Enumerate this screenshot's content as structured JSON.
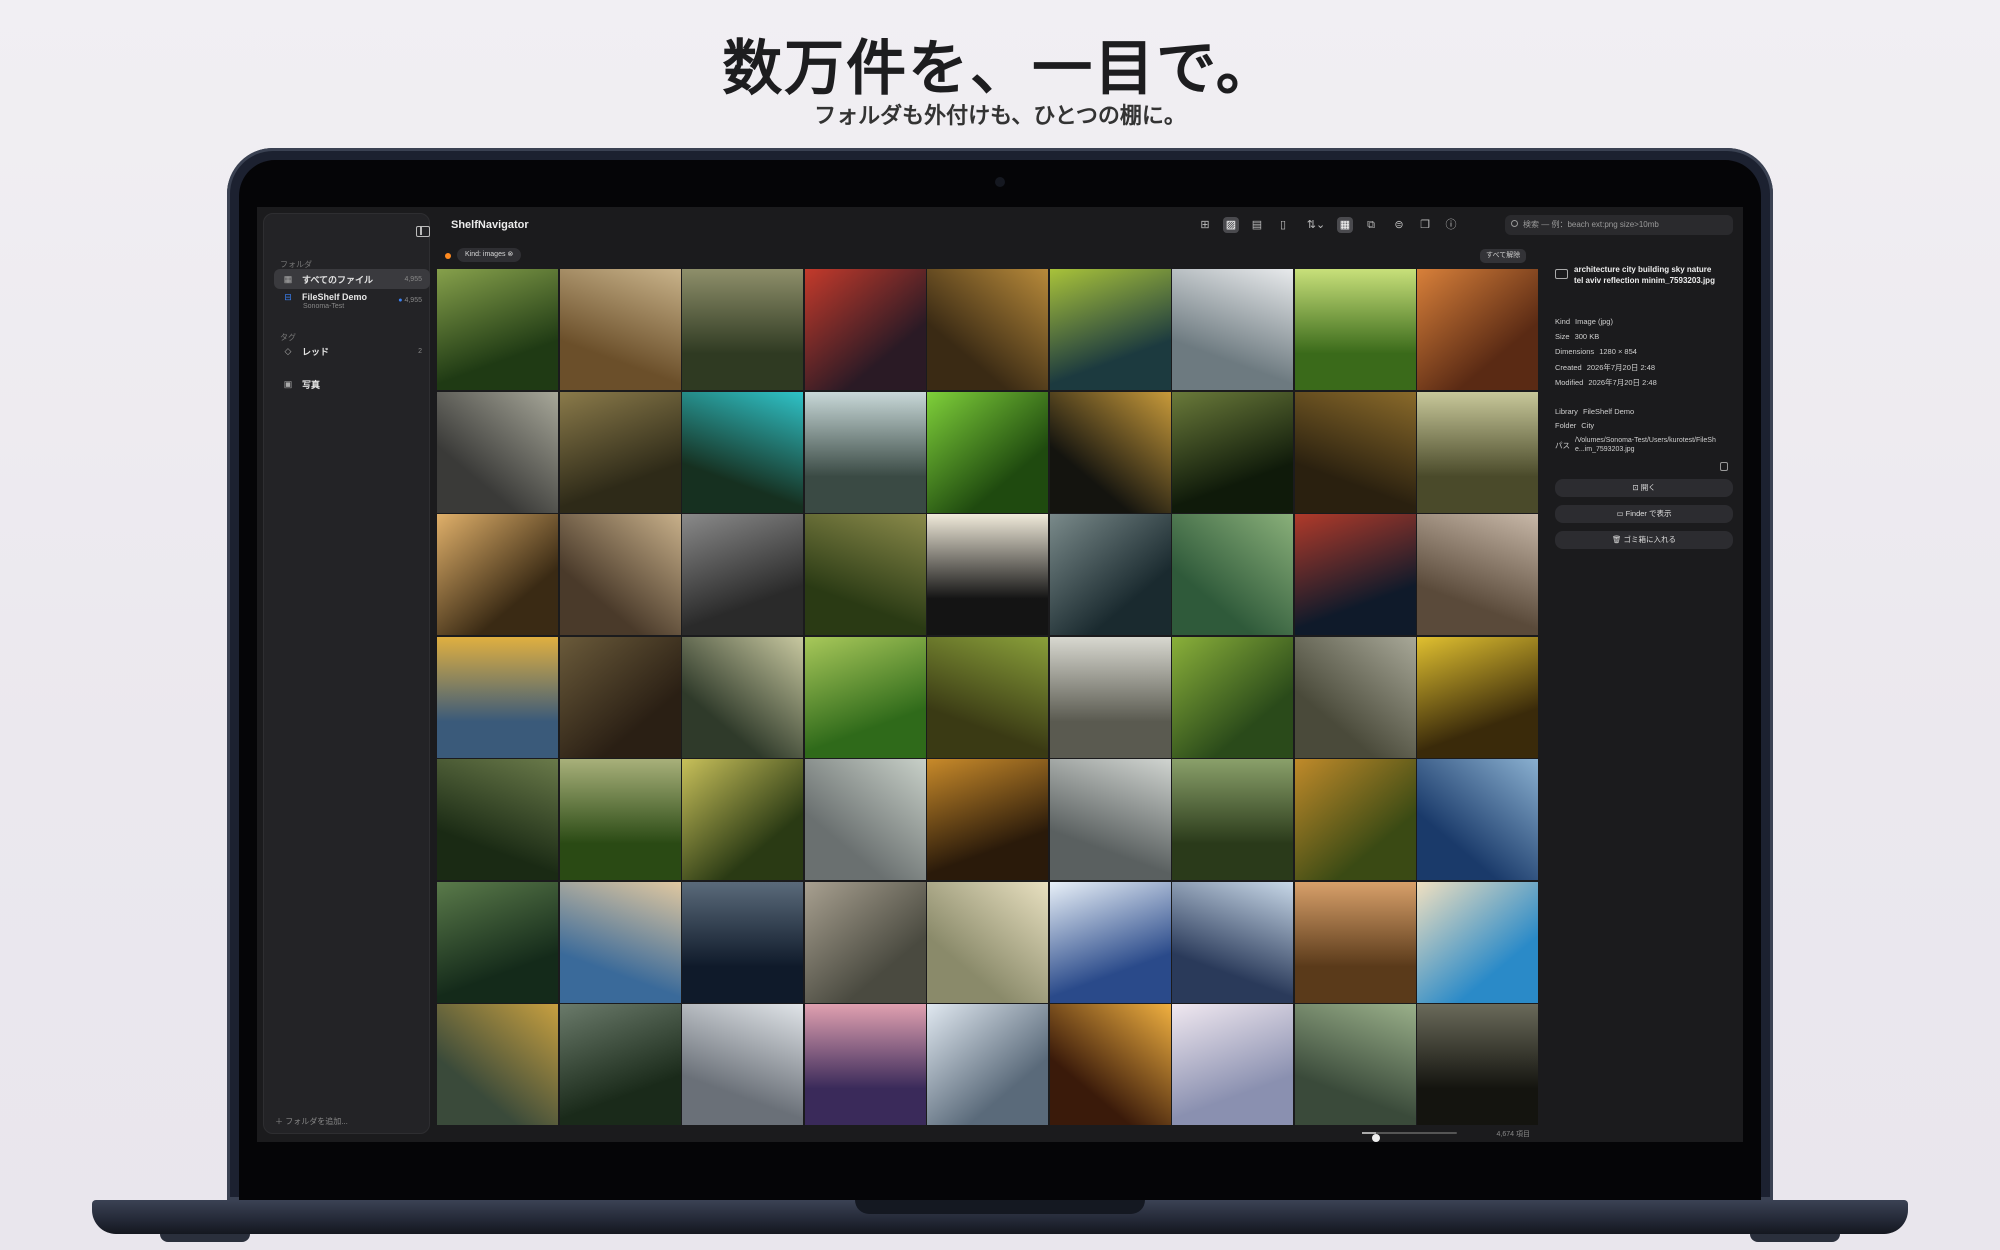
{
  "hero": {
    "title": "数万件を、一目で。",
    "subtitle": "フォルダも外付けも、ひとつの棚に。"
  },
  "app": {
    "title": "ShelfNavigator",
    "search_placeholder": "検索 — 例：beach ext:png size>10mb"
  },
  "sidebar": {
    "folders_section": "フォルダ",
    "items": [
      {
        "label": "すべてのファイル",
        "count": "4,955",
        "icon": "grid-icon"
      },
      {
        "label": "FileShelf Demo",
        "sub": "Sonoma-Test",
        "count": "4,955",
        "icon": "drive-icon"
      }
    ],
    "tags_section": "タグ",
    "tags": [
      {
        "label": "レッド",
        "count": "2",
        "icon": "tag-icon"
      },
      {
        "label": "写真",
        "count": "",
        "icon": "photos-icon"
      }
    ],
    "add_folder": "＋ フォルダを追加..."
  },
  "filter": {
    "chip": "Kind: images ⊗",
    "clear_all": "すべて解除"
  },
  "inspector": {
    "filename": "architecture city building sky nature tel aviv reflection minim_7593203.jpg",
    "kind_label": "Kind",
    "kind": "Image (jpg)",
    "size_label": "Size",
    "size": "300 KB",
    "dimensions_label": "Dimensions",
    "dimensions": "1280 × 854",
    "created_label": "Created",
    "created": "2026年7月20日 2:48",
    "modified_label": "Modified",
    "modified": "2026年7月20日 2:48",
    "library_label": "Library",
    "library": "FileShelf Demo",
    "folder_label": "Folder",
    "folder": "City",
    "path_label": "パス",
    "path": "/Volumes/Sonoma-Test/Users/kurotest/FileShe...im_7593203.jpg",
    "open_button": "開く",
    "finder_button": "Finder で表示",
    "trash_button": "ゴミ箱に入れる"
  },
  "status": {
    "item_count": "4,674 項目",
    "zoom_level": 0.15
  },
  "colors": {
    "accent_orange": "#ff8a1f",
    "drive_blue": "#3b82f6",
    "screen_bg": "#1b1b1d"
  },
  "thumbnails": [
    {
      "a": "#1f3a14",
      "b": "#86a04b"
    },
    {
      "a": "#6b4f2a",
      "b": "#c9b38a"
    },
    {
      "a": "#2f3a22",
      "b": "#8e8f6a"
    },
    {
      "a": "#2a1a25",
      "b": "#c43a2b"
    },
    {
      "a": "#3a2a14",
      "b": "#b88a3a"
    },
    {
      "a": "#1c3a3f",
      "b": "#a8c23a"
    },
    {
      "a": "#6d7a80",
      "b": "#e8eaec"
    },
    {
      "a": "#3a6a1a",
      "b": "#c8e07a"
    },
    {
      "a": "#5a2a14",
      "b": "#d8803a"
    },
    {
      "a": "#3a3a38",
      "b": "#a8a89a"
    },
    {
      "a": "#2e2a18",
      "b": "#8a7a4a"
    },
    {
      "a": "#163020",
      "b": "#2fc3c8"
    },
    {
      "a": "#3a4a44",
      "b": "#c8d8d8"
    },
    {
      "a": "#1f4a0f",
      "b": "#7fd03a"
    },
    {
      "a": "#14140f",
      "b": "#c89a3a"
    },
    {
      "a": "#0f1a0a",
      "b": "#6a7a3a"
    },
    {
      "a": "#2a200f",
      "b": "#8a6a2a"
    },
    {
      "a": "#4a4a2a",
      "b": "#c8c89a"
    },
    {
      "a": "#3a2a14",
      "b": "#e0b06a"
    },
    {
      "a": "#4a3a2a",
      "b": "#c8b08a"
    },
    {
      "a": "#2a2a2a",
      "b": "#8a8a8a"
    },
    {
      "a": "#2a3a14",
      "b": "#8a8a4a"
    },
    {
      "a": "#141414",
      "b": "#f0eada"
    },
    {
      "a": "#1a2a2f",
      "b": "#7a8a8a"
    },
    {
      "a": "#2f5a3a",
      "b": "#8ab07a"
    },
    {
      "a": "#0f1a2a",
      "b": "#b03a2a"
    },
    {
      "a": "#5a4a3a",
      "b": "#c8b8a8"
    },
    {
      "a": "#3a5a7a",
      "b": "#e0b040"
    },
    {
      "a": "#2a1f14",
      "b": "#6a5a3a"
    },
    {
      "a": "#2f3a2a",
      "b": "#c8c8a0"
    },
    {
      "a": "#2f6a1a",
      "b": "#a8c85a"
    },
    {
      "a": "#3a3a14",
      "b": "#8aa03a"
    },
    {
      "a": "#5a5a50",
      "b": "#d8d8d0"
    },
    {
      "a": "#2a4a1a",
      "b": "#8ab03a"
    },
    {
      "a": "#4a4a3a",
      "b": "#a8a898"
    },
    {
      "a": "#3a2a0a",
      "b": "#e0c030"
    },
    {
      "a": "#1a2a14",
      "b": "#6a7a4a"
    },
    {
      "a": "#2a4a14",
      "b": "#a8b07a"
    },
    {
      "a": "#2a3a14",
      "b": "#c8c05a"
    },
    {
      "a": "#6a7070",
      "b": "#c8d0c8"
    },
    {
      "a": "#2a1a0a",
      "b": "#c88a2a"
    },
    {
      "a": "#5a6060",
      "b": "#d0d4d0"
    },
    {
      "a": "#2a3a1a",
      "b": "#8aa06a"
    },
    {
      "a": "#3a4a14",
      "b": "#c08a2a"
    },
    {
      "a": "#1a3a6a",
      "b": "#8ab0d0"
    },
    {
      "a": "#142a1a",
      "b": "#5a7a4a"
    },
    {
      "a": "#3a6a9a",
      "b": "#e0c8a0"
    },
    {
      "a": "#0f1a2a",
      "b": "#5a6a7a"
    },
    {
      "a": "#4a4a40",
      "b": "#a8a090"
    },
    {
      "a": "#8a8a6a",
      "b": "#e8e0c0"
    },
    {
      "a": "#2a4a8a",
      "b": "#e8f0f8"
    },
    {
      "a": "#2a3a5a",
      "b": "#c8d8e8"
    },
    {
      "a": "#5a3a1a",
      "b": "#d8a06a"
    },
    {
      "a": "#2a8ac8",
      "b": "#f0e0c0"
    },
    {
      "a": "#3a4a3a",
      "b": "#c8a040"
    },
    {
      "a": "#1a2a1a",
      "b": "#6a7a6a"
    },
    {
      "a": "#6a7078",
      "b": "#e0e4e8"
    },
    {
      "a": "#3a2a5a",
      "b": "#e0a0b0"
    },
    {
      "a": "#5a6a7a",
      "b": "#e0e8f0"
    },
    {
      "a": "#3a1a0a",
      "b": "#f0b040"
    },
    {
      "a": "#8a90b0",
      "b": "#f0e8f0"
    },
    {
      "a": "#3a4a3a",
      "b": "#9ab08a"
    },
    {
      "a": "#14140f",
      "b": "#6a6a5a"
    },
    {
      "a": "#1a6ac8",
      "b": "#8ac0f0"
    },
    {
      "a": "#3a3a3a",
      "b": "#7a7a7a"
    },
    {
      "a": "#5a3a1a",
      "b": "#e0a050"
    },
    {
      "a": "#4a5a6a",
      "b": "#b0c0d0"
    },
    {
      "a": "#3a4a5a",
      "b": "#c0c8d0"
    },
    {
      "a": "#5a6a7a",
      "b": "#d0d8e0"
    },
    {
      "a": "#6a7a8a",
      "b": "#d8e0e8"
    },
    {
      "a": "#6a4a3a",
      "b": "#c8a080"
    },
    {
      "a": "#3a3a3a",
      "b": "#8a8a8a"
    }
  ]
}
